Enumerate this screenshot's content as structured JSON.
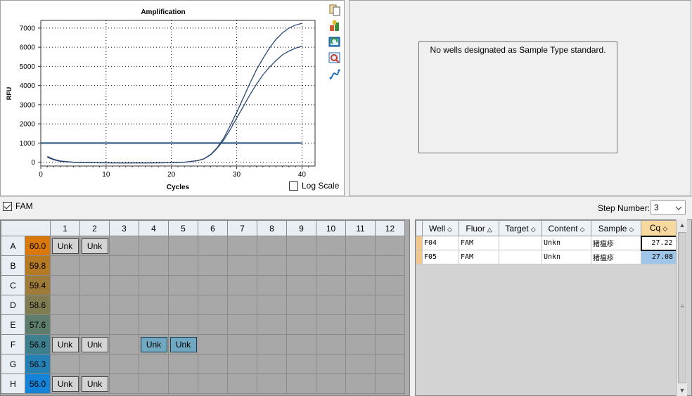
{
  "chart_data": {
    "type": "line",
    "title": "Amplification",
    "xlabel": "Cycles",
    "ylabel": "RFU",
    "xlim": [
      0,
      42
    ],
    "ylim": [
      -200,
      7400
    ],
    "x_ticks": [
      0,
      10,
      20,
      30,
      40
    ],
    "y_ticks": [
      0,
      1000,
      2000,
      3000,
      4000,
      5000,
      6000,
      7000
    ],
    "grid": true,
    "threshold": 1000,
    "series": [
      {
        "x": [
          1,
          2,
          3,
          5,
          8,
          12,
          16,
          20,
          22,
          24,
          25,
          26,
          27,
          28,
          29,
          30,
          31,
          32,
          33,
          34,
          35,
          36,
          37,
          38,
          39,
          40
        ],
        "y": [
          300,
          150,
          60,
          0,
          -30,
          -40,
          -40,
          -30,
          0,
          80,
          180,
          400,
          750,
          1250,
          1900,
          2600,
          3350,
          4100,
          4800,
          5400,
          5950,
          6400,
          6750,
          7000,
          7150,
          7250
        ]
      },
      {
        "x": [
          1,
          2,
          3,
          5,
          8,
          12,
          16,
          20,
          22,
          24,
          25,
          26,
          27,
          28,
          29,
          30,
          31,
          32,
          33,
          34,
          35,
          36,
          37,
          38,
          39,
          40
        ],
        "y": [
          250,
          120,
          40,
          -10,
          -30,
          -40,
          -40,
          -30,
          0,
          80,
          170,
          380,
          720,
          1150,
          1700,
          2300,
          2900,
          3500,
          4050,
          4550,
          4950,
          5300,
          5600,
          5800,
          5950,
          6050
        ]
      }
    ],
    "colors": {
      "curve": "#2b4a73",
      "threshold": "#1f4e79",
      "grid": "#000000"
    }
  },
  "chart_panel": {
    "log_scale_label": "Log Scale",
    "log_scale_checked": false
  },
  "toolbar_icons": [
    "copy-icon",
    "export-icon",
    "refresh-icon",
    "zoom-icon",
    "curve-icon"
  ],
  "standard_panel": {
    "message": "No wells designated as Sample Type standard."
  },
  "fluor_filter": {
    "label": "FAM",
    "checked": true
  },
  "step": {
    "label": "Step Number:",
    "value": "3"
  },
  "plate": {
    "columns": [
      "1",
      "2",
      "3",
      "4",
      "5",
      "6",
      "7",
      "8",
      "9",
      "10",
      "11",
      "12"
    ],
    "rows": [
      {
        "label": "A",
        "temp": "60.0",
        "temp_color": "#d9790b",
        "wells": [
          "Unk",
          "Unk",
          "",
          "",
          "",
          "",
          "",
          "",
          "",
          "",
          "",
          ""
        ]
      },
      {
        "label": "B",
        "temp": "59.8",
        "temp_color": "#b67a24",
        "wells": [
          "",
          "",
          "",
          "",
          "",
          "",
          "",
          "",
          "",
          "",
          "",
          ""
        ]
      },
      {
        "label": "C",
        "temp": "59.4",
        "temp_color": "#9e7b38",
        "wells": [
          "",
          "",
          "",
          "",
          "",
          "",
          "",
          "",
          "",
          "",
          "",
          ""
        ]
      },
      {
        "label": "D",
        "temp": "58.6",
        "temp_color": "#7f7c52",
        "wells": [
          "",
          "",
          "",
          "",
          "",
          "",
          "",
          "",
          "",
          "",
          "",
          ""
        ]
      },
      {
        "label": "E",
        "temp": "57.6",
        "temp_color": "#5f7d6c",
        "wells": [
          "",
          "",
          "",
          "",
          "",
          "",
          "",
          "",
          "",
          "",
          "",
          ""
        ]
      },
      {
        "label": "F",
        "temp": "56.8",
        "temp_color": "#3e7f8e",
        "wells": [
          "Unk",
          "Unk",
          "",
          "Unk",
          "Unk",
          "",
          "",
          "",
          "",
          "",
          "",
          ""
        ]
      },
      {
        "label": "G",
        "temp": "56.3",
        "temp_color": "#2580b3",
        "wells": [
          "",
          "",
          "",
          "",
          "",
          "",
          "",
          "",
          "",
          "",
          "",
          ""
        ]
      },
      {
        "label": "H",
        "temp": "56.0",
        "temp_color": "#1584d8",
        "wells": [
          "Unk",
          "Unk",
          "",
          "",
          "",
          "",
          "",
          "",
          "",
          "",
          "",
          ""
        ]
      }
    ],
    "selected_wells": [
      "F4",
      "F5"
    ]
  },
  "results": {
    "headers": [
      "Well",
      "Fluor",
      "Target",
      "Content",
      "Sample",
      "Cq"
    ],
    "rows": [
      {
        "well": "F04",
        "fluor": "FAM",
        "target": "",
        "content": "Unkn",
        "sample": "猪瘟疹",
        "cq": "27.22"
      },
      {
        "well": "F05",
        "fluor": "FAM",
        "target": "",
        "content": "Unkn",
        "sample": "猪瘟疹",
        "cq": "27.08"
      }
    ]
  }
}
